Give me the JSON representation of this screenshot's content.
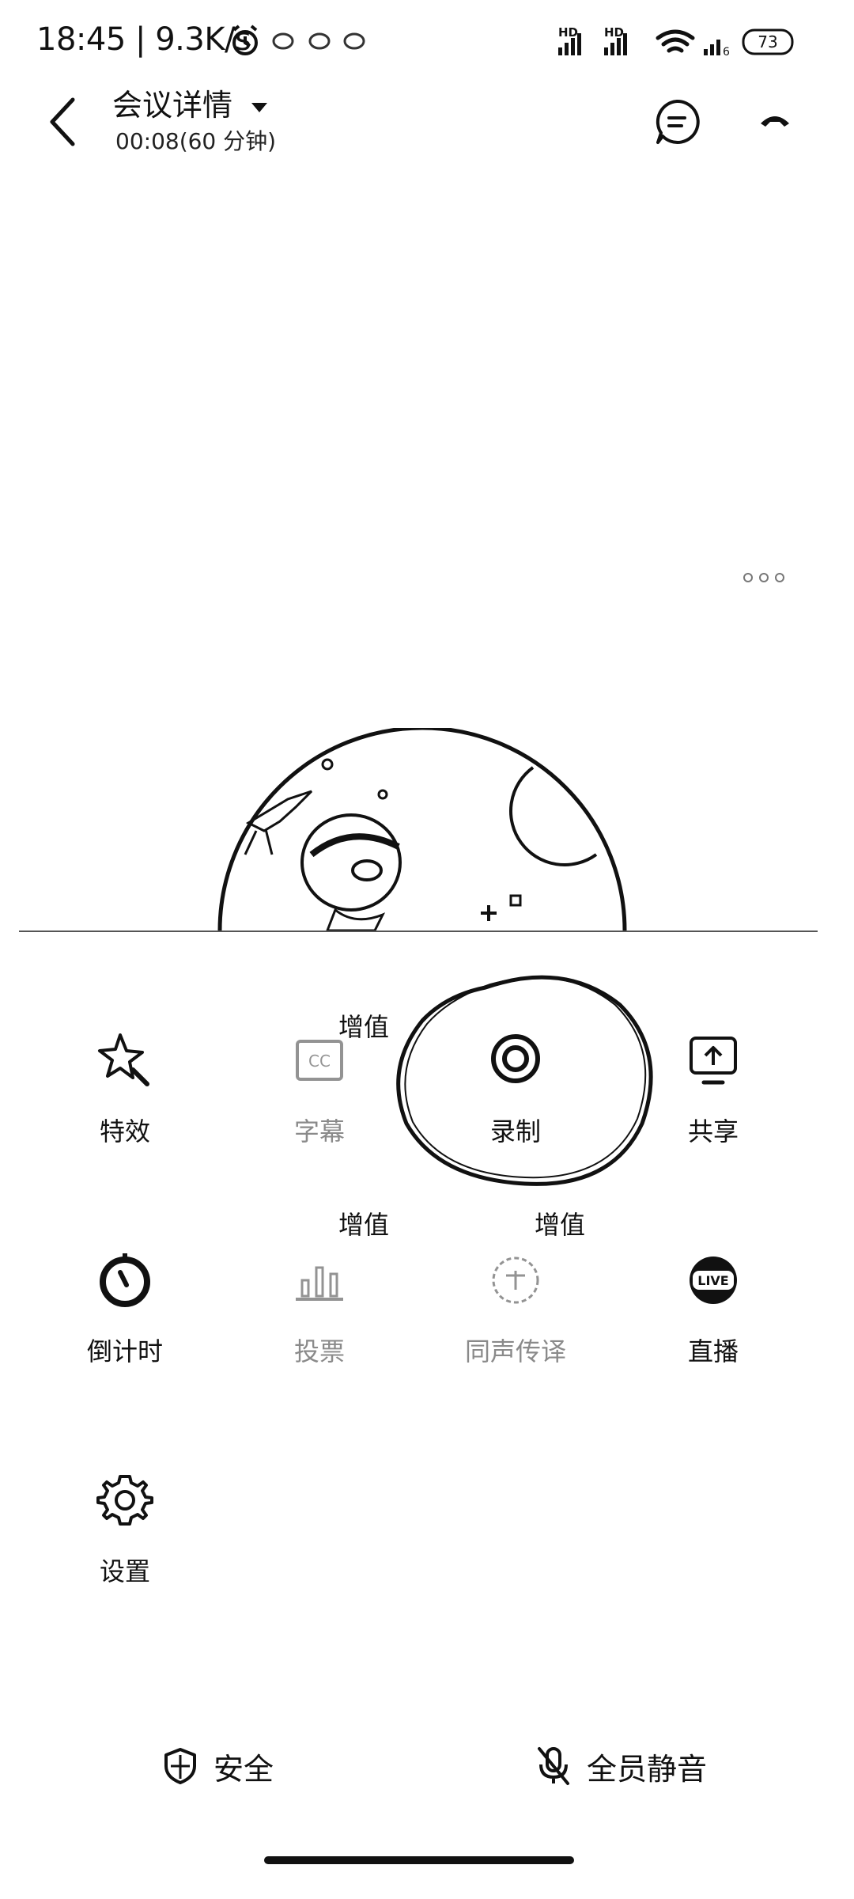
{
  "status_bar": {
    "time": "18:45",
    "speed": "9.3K/s",
    "hd1": "HD",
    "hd2": "HD",
    "battery": "73"
  },
  "header": {
    "title": "会议详情",
    "subtitle": "00:08(60 分钟)"
  },
  "tools": [
    {
      "label": "特效",
      "icon": "magic-wand-icon"
    },
    {
      "label": "字幕",
      "icon": "subtitles-icon",
      "badge": "增值"
    },
    {
      "label": "录制",
      "icon": "record-icon"
    },
    {
      "label": "共享",
      "icon": "screen-share-icon"
    },
    {
      "label": "倒计时",
      "icon": "timer-icon"
    },
    {
      "label": "投票",
      "icon": "poll-icon",
      "badge": "增值"
    },
    {
      "label": "同声传译",
      "icon": "interpretation-icon",
      "badge": "增值"
    },
    {
      "label": "直播",
      "icon": "live-icon"
    },
    {
      "label": "设置",
      "icon": "gear-icon"
    }
  ],
  "footer": {
    "security_label": "安全",
    "mute_all_label": "全员静音"
  }
}
